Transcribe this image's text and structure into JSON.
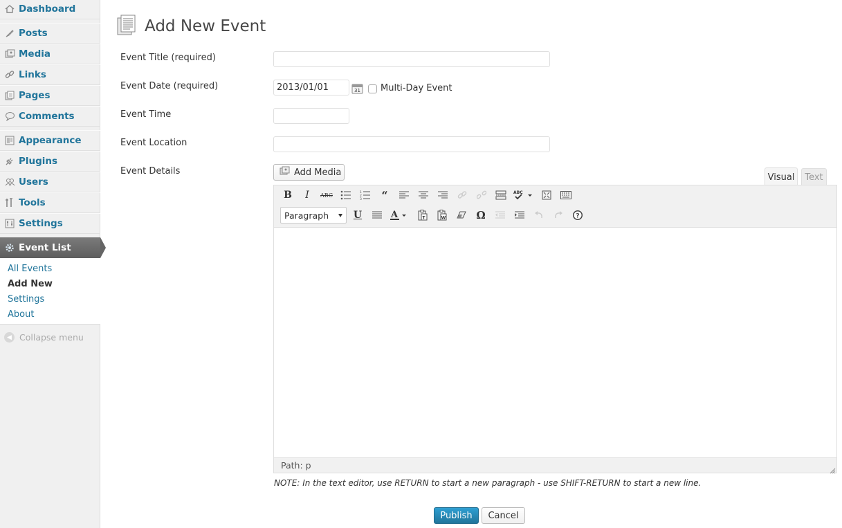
{
  "sidebar": {
    "items": [
      {
        "label": "Dashboard",
        "icon": "dashboard-icon"
      },
      {
        "label": "Posts",
        "icon": "posts-icon"
      },
      {
        "label": "Media",
        "icon": "media-icon"
      },
      {
        "label": "Links",
        "icon": "links-icon"
      },
      {
        "label": "Pages",
        "icon": "pages-icon"
      },
      {
        "label": "Comments",
        "icon": "comments-icon"
      },
      {
        "label": "Appearance",
        "icon": "appearance-icon"
      },
      {
        "label": "Plugins",
        "icon": "plugins-icon"
      },
      {
        "label": "Users",
        "icon": "users-icon"
      },
      {
        "label": "Tools",
        "icon": "tools-icon"
      },
      {
        "label": "Settings",
        "icon": "settings-icon"
      },
      {
        "label": "Event List",
        "icon": "gear-icon",
        "active": true
      }
    ],
    "submenu": [
      "All Events",
      "Add New",
      "Settings",
      "About"
    ],
    "submenu_current": "Add New",
    "collapse_label": "Collapse menu"
  },
  "page": {
    "title": "Add New Event"
  },
  "form": {
    "title_label": "Event Title (required)",
    "title_value": "",
    "date_label": "Event Date (required)",
    "date_value": "2013/01/01",
    "multiday_label": "Multi-Day Event",
    "multiday_checked": false,
    "time_label": "Event Time",
    "time_value": "",
    "location_label": "Event Location",
    "location_value": "",
    "details_label": "Event Details"
  },
  "editor": {
    "add_media_label": "Add Media",
    "tab_visual": "Visual",
    "tab_text": "Text",
    "format_value": "Paragraph",
    "path_label": "Path: p",
    "note": "NOTE: In the text editor, use RETURN to start a new paragraph - use SHIFT-RETURN to start a new line."
  },
  "actions": {
    "publish_label": "Publish",
    "cancel_label": "Cancel"
  },
  "colors": {
    "accent": "#21759b",
    "sidebar_bg": "#f0f0f0",
    "active_menu": "#656565"
  }
}
